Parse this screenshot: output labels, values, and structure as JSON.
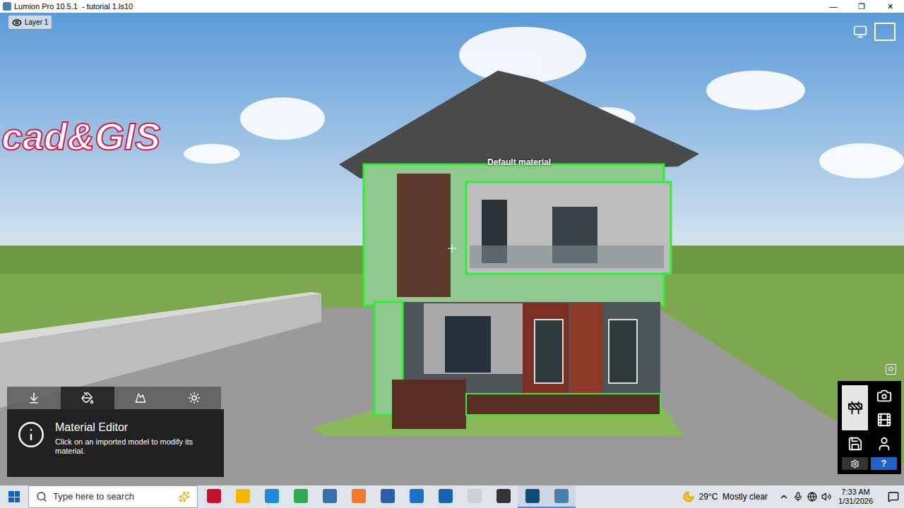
{
  "window": {
    "title": "Lumion Pro 10.5.1  - tutorial 1.ls10",
    "controls": [
      "—",
      "❐",
      "✕"
    ]
  },
  "viewport": {
    "layer": "Layer 1",
    "watermark": "cad&GIS",
    "hover_label": "Default material",
    "corner_toggle": "O"
  },
  "editor_panel": {
    "tabs": [
      {
        "kind": "import",
        "selected": false
      },
      {
        "kind": "material",
        "selected": true
      },
      {
        "kind": "landscape",
        "selected": false
      },
      {
        "kind": "weather",
        "selected": false
      }
    ],
    "info": {
      "title": "Material Editor",
      "text": "Click on an imported model to modify its material."
    }
  },
  "right_toolbar": {
    "buttons": [
      {
        "kind": "build",
        "selected": true
      },
      {
        "kind": "photo",
        "selected": false
      },
      {
        "kind": "movie",
        "selected": false
      },
      {
        "kind": "save",
        "selected": false
      },
      {
        "kind": "avatar",
        "selected": false
      }
    ],
    "footer": [
      {
        "kind": "settings",
        "label": ""
      },
      {
        "kind": "help",
        "label": "?"
      }
    ]
  },
  "taskbar": {
    "search": {
      "placeholder": "Type here to search"
    },
    "apps": [
      {
        "kind": "autocad",
        "color": "#c8102e",
        "active": false
      },
      {
        "kind": "explorer",
        "color": "#f2b600",
        "active": false
      },
      {
        "kind": "edge",
        "color": "#1f8ad6",
        "active": false
      },
      {
        "kind": "chrome",
        "color": "#34a853",
        "active": false
      },
      {
        "kind": "store",
        "color": "#3b6ea8",
        "active": false
      },
      {
        "kind": "xampp",
        "color": "#f07a2e",
        "active": false
      },
      {
        "kind": "arcmap",
        "color": "#2d5fa8",
        "active": false
      },
      {
        "kind": "autodesk",
        "color": "#1d6fc9",
        "active": false
      },
      {
        "kind": "sketchup",
        "color": "#1863b8",
        "active": false
      },
      {
        "kind": "paint",
        "color": "#d0d0d0",
        "active": false
      },
      {
        "kind": "inkscape",
        "color": "#333333",
        "active": false
      },
      {
        "kind": "code",
        "color": "#0f4c75",
        "active": true
      },
      {
        "kind": "lumion",
        "color": "#4a7fb0",
        "active": true
      }
    ],
    "weather": "29°C  Mostly clear",
    "time": "7:33 AM",
    "date": "1/31/2026"
  }
}
